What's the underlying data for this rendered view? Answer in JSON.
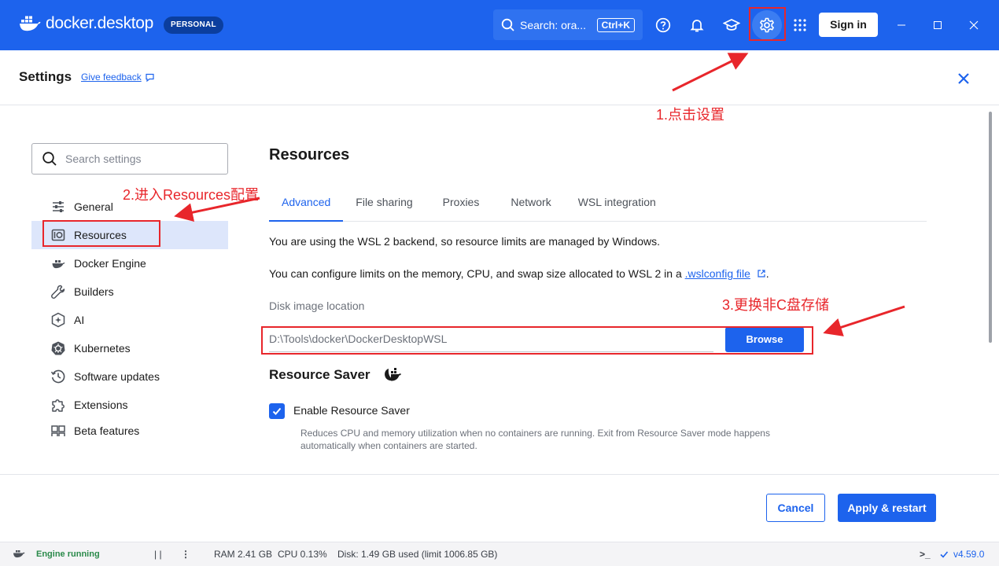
{
  "titlebar": {
    "brand": "docker.desktop",
    "badge": "PERSONAL",
    "search_text": "Search: ora...",
    "search_shortcut": "Ctrl+K",
    "sign_in_label": "Sign in"
  },
  "header": {
    "title": "Settings",
    "feedback_link": "Give feedback"
  },
  "sidebar": {
    "search_placeholder": "Search settings",
    "items": [
      {
        "label": "General",
        "icon": "sliders-icon"
      },
      {
        "label": "Resources",
        "icon": "disk-icon",
        "active": true
      },
      {
        "label": "Docker Engine",
        "icon": "whale-icon"
      },
      {
        "label": "Builders",
        "icon": "wrench-icon"
      },
      {
        "label": "AI",
        "icon": "sparkle-icon"
      },
      {
        "label": "Kubernetes",
        "icon": "helm-icon"
      },
      {
        "label": "Software updates",
        "icon": "clock-icon"
      },
      {
        "label": "Extensions",
        "icon": "puzzle-icon"
      },
      {
        "label": "Beta features",
        "icon": "grid-icon"
      }
    ]
  },
  "main": {
    "title": "Resources",
    "tabs": [
      "Advanced",
      "File sharing",
      "Proxies",
      "Network",
      "WSL integration"
    ],
    "active_tab": "Advanced",
    "wsl_note": "You are using the WSL 2 backend, so resource limits are managed by Windows.",
    "configure_prefix": "You can configure limits on the memory, CPU, and swap size allocated to WSL 2 in a",
    "configure_link": ".wslconfig file",
    "configure_suffix": ".",
    "disk_label": "Disk image location",
    "disk_path": "D:\\Tools\\docker\\DockerDesktopWSL",
    "browse_label": "Browse",
    "saver_title": "Resource Saver",
    "saver_checkbox_label": "Enable Resource Saver",
    "saver_checked": true,
    "saver_help": "Reduces CPU and memory utilization when no containers are running. Exit from Resource Saver mode happens automatically when containers are started."
  },
  "footer": {
    "cancel_label": "Cancel",
    "apply_label": "Apply & restart"
  },
  "statusbar": {
    "engine": "Engine running",
    "pause": "| |",
    "more": "⋮",
    "ram": "RAM 2.41 GB",
    "cpu": "CPU 0.13%",
    "disk": "Disk: 1.49 GB used (limit 1006.85 GB)",
    "terminal": ">_",
    "version": "v4.59.0"
  },
  "annotations": {
    "step1": "1.点击设置",
    "step2": "2.进入Resources配置",
    "step3": "3.更换非C盘存储",
    "color": "#e8262b"
  },
  "colors": {
    "accent": "#1d63ed",
    "titlebar": "#1d63ed",
    "engine_ok": "#2a8a4a"
  }
}
